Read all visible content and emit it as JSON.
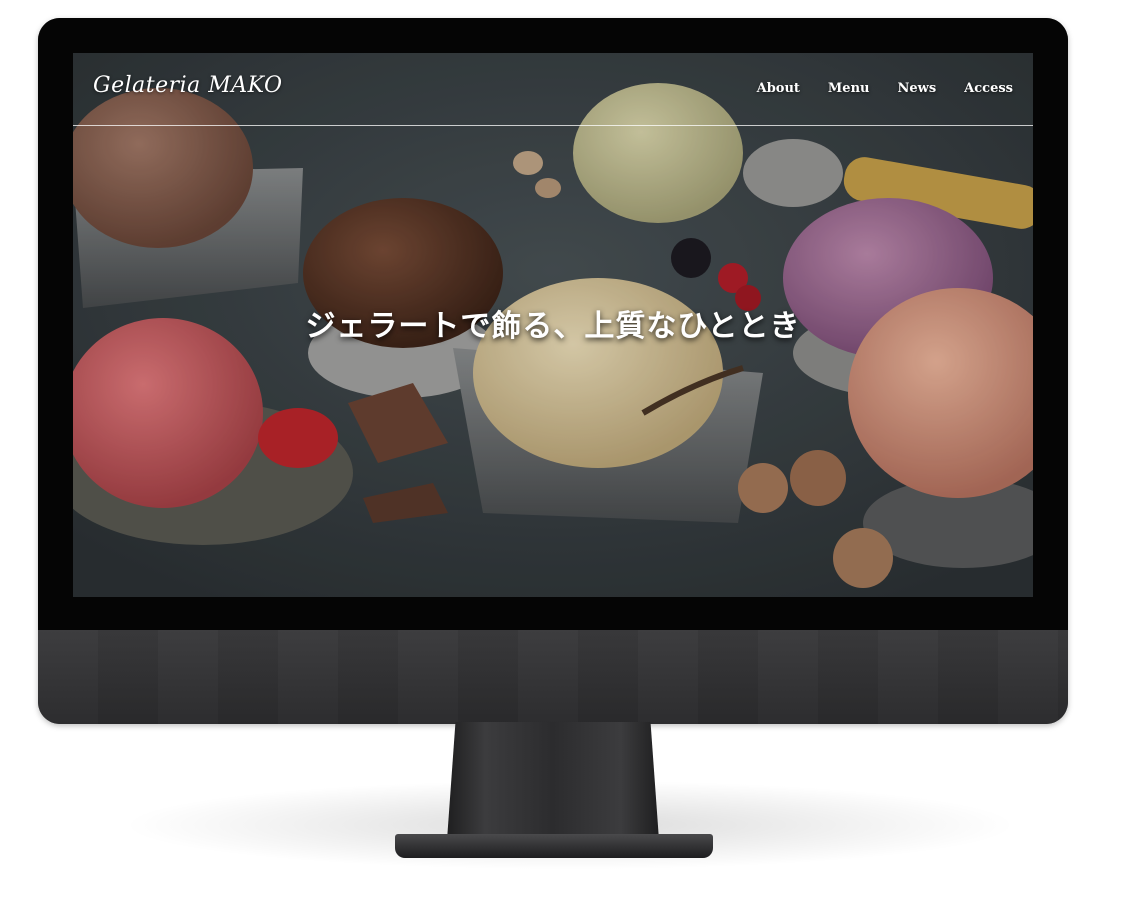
{
  "site": {
    "logo": "Gelateria MAKO",
    "nav": [
      {
        "label": "About"
      },
      {
        "label": "Menu"
      },
      {
        "label": "News"
      },
      {
        "label": "Access"
      }
    ],
    "hero_tagline": "ジェラートで飾る、上質なひととき"
  },
  "colors": {
    "background_slate": "#3b4246",
    "chocolate": "#5b3a2c",
    "milk_chocolate": "#8a6352",
    "pistachio": "#c9c79a",
    "berry": "#a9739a",
    "strawberry": "#d56468",
    "vanilla": "#e5d3a8",
    "peach": "#e0a189"
  },
  "icons": {
    "device": "monitor-frame"
  }
}
